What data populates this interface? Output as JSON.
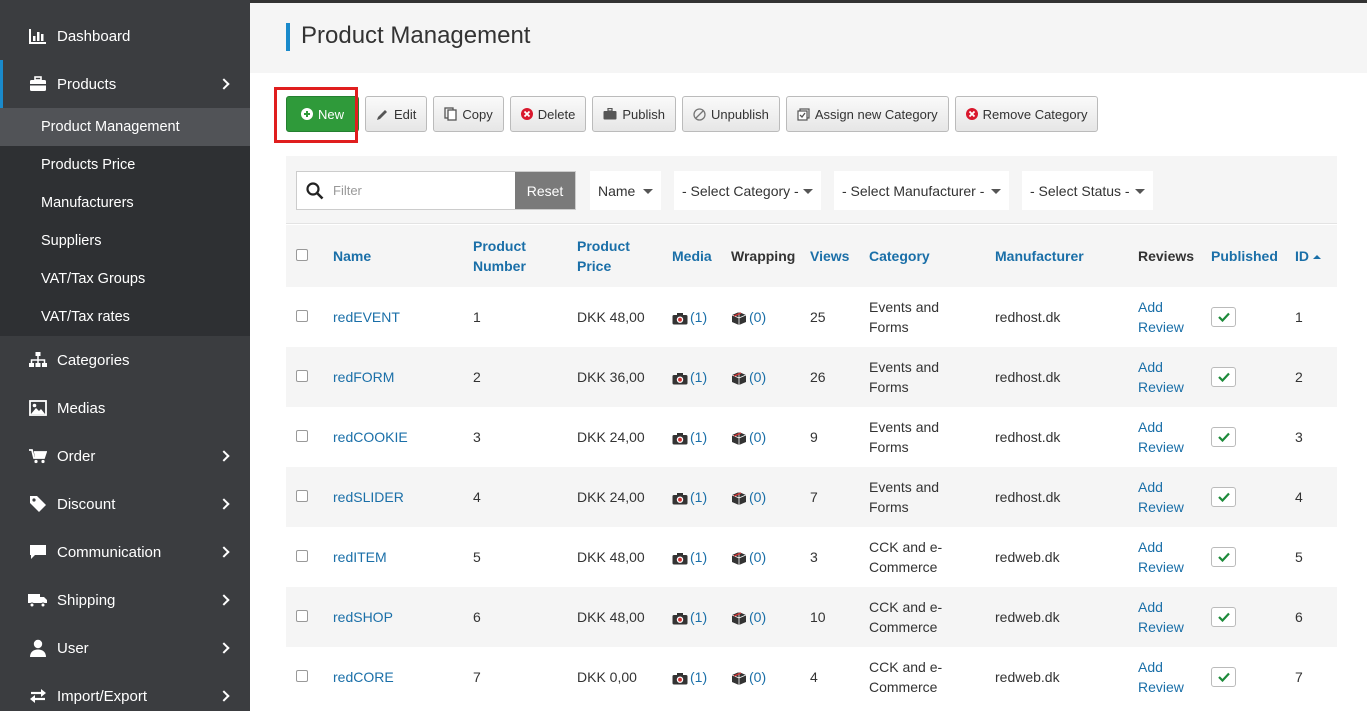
{
  "sidebar": {
    "items": [
      {
        "label": "Dashboard",
        "icon": "bar-chart-icon"
      },
      {
        "label": "Products",
        "icon": "briefcase-icon"
      },
      {
        "label": "Categories",
        "icon": "sitemap-icon"
      },
      {
        "label": "Medias",
        "icon": "image-icon"
      },
      {
        "label": "Order",
        "icon": "cart-icon"
      },
      {
        "label": "Discount",
        "icon": "tag-icon"
      },
      {
        "label": "Communication",
        "icon": "comment-icon"
      },
      {
        "label": "Shipping",
        "icon": "truck-icon"
      },
      {
        "label": "User",
        "icon": "user-icon"
      },
      {
        "label": "Import/Export",
        "icon": "exchange-icon"
      }
    ],
    "products_submenu": [
      "Product Management",
      "Products Price",
      "Manufacturers",
      "Suppliers",
      "VAT/Tax Groups",
      "VAT/Tax rates"
    ]
  },
  "page": {
    "title": "Product Management"
  },
  "toolbar": {
    "new": "New",
    "edit": "Edit",
    "copy": "Copy",
    "delete": "Delete",
    "publish": "Publish",
    "unpublish": "Unpublish",
    "assign_category": "Assign new Category",
    "remove_category": "Remove Category"
  },
  "filters": {
    "search_placeholder": "Filter",
    "reset": "Reset",
    "sort_by": "Name",
    "category": "- Select Category -",
    "manufacturer": "- Select Manufacturer -",
    "status": "- Select Status -"
  },
  "table": {
    "headers": {
      "name": "Name",
      "product_number_1": "Product",
      "product_number_2": "Number",
      "product_price_1": "Product",
      "product_price_2": "Price",
      "media": "Media",
      "wrapping": "Wrapping",
      "views": "Views",
      "category": "Category",
      "manufacturer": "Manufacturer",
      "reviews": "Reviews",
      "published": "Published",
      "id": "ID"
    },
    "rows": [
      {
        "name": "redEVENT",
        "number": "1",
        "price": "DKK 48,00",
        "media": "(1)",
        "wrapping": "(0)",
        "views": "25",
        "category_1": "Events and",
        "category_2": "Forms",
        "manufacturer": "redhost.dk",
        "review_1": "Add",
        "review_2": "Review",
        "id": "1"
      },
      {
        "name": "redFORM",
        "number": "2",
        "price": "DKK 36,00",
        "media": "(1)",
        "wrapping": "(0)",
        "views": "26",
        "category_1": "Events and",
        "category_2": "Forms",
        "manufacturer": "redhost.dk",
        "review_1": "Add",
        "review_2": "Review",
        "id": "2"
      },
      {
        "name": "redCOOKIE",
        "number": "3",
        "price": "DKK 24,00",
        "media": "(1)",
        "wrapping": "(0)",
        "views": "9",
        "category_1": "Events and",
        "category_2": "Forms",
        "manufacturer": "redhost.dk",
        "review_1": "Add",
        "review_2": "Review",
        "id": "3"
      },
      {
        "name": "redSLIDER",
        "number": "4",
        "price": "DKK 24,00",
        "media": "(1)",
        "wrapping": "(0)",
        "views": "7",
        "category_1": "Events and",
        "category_2": "Forms",
        "manufacturer": "redhost.dk",
        "review_1": "Add",
        "review_2": "Review",
        "id": "4"
      },
      {
        "name": "redITEM",
        "number": "5",
        "price": "DKK 48,00",
        "media": "(1)",
        "wrapping": "(0)",
        "views": "3",
        "category_1": "CCK and e-",
        "category_2": "Commerce",
        "manufacturer": "redweb.dk",
        "review_1": "Add",
        "review_2": "Review",
        "id": "5"
      },
      {
        "name": "redSHOP",
        "number": "6",
        "price": "DKK 48,00",
        "media": "(1)",
        "wrapping": "(0)",
        "views": "10",
        "category_1": "CCK and e-",
        "category_2": "Commerce",
        "manufacturer": "redweb.dk",
        "review_1": "Add",
        "review_2": "Review",
        "id": "6"
      },
      {
        "name": "redCORE",
        "number": "7",
        "price": "DKK 0,00",
        "media": "(1)",
        "wrapping": "(0)",
        "views": "4",
        "category_1": "CCK and e-",
        "category_2": "Commerce",
        "manufacturer": "redweb.dk",
        "review_1": "Add",
        "review_2": "Review",
        "id": "7"
      }
    ]
  },
  "colors": {
    "accent": "#1a8acb",
    "link": "#1a6fa8",
    "new_button": "#2f9a3a",
    "highlight": "#e01e1e",
    "sidebar": "#3b3d40"
  }
}
